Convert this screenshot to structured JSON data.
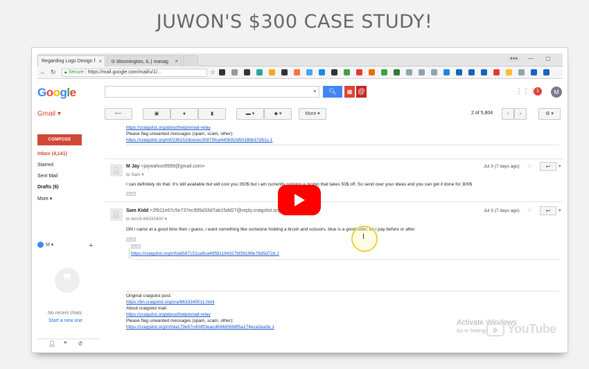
{
  "headline": "JUWON'S $300 CASE STUDY!",
  "browser": {
    "tabs": [
      "Regarding Logo Design f",
      "bloomington, IL | manag"
    ],
    "url_secure": "Secure",
    "url": "https://mail.google.com/mail/u/1/...",
    "minimize": "—",
    "restore": "▢"
  },
  "gmail": {
    "logo": "Google",
    "label": "Gmail ▾",
    "compose": "COMPOSE",
    "nav": [
      {
        "label": "Inbox (4,141)",
        "style": "red"
      },
      {
        "label": "Starred",
        "style": ""
      },
      {
        "label": "Sent Mail",
        "style": ""
      },
      {
        "label": "Drafts (6)",
        "style": "bold"
      },
      {
        "label": "More ▾",
        "style": ""
      }
    ],
    "hangouts_user": "M ▾",
    "no_chats": "No recent chats",
    "start_new": "Start a new one",
    "toolbar": {
      "more": "More ▾",
      "count": "2 of 5,804"
    },
    "notif_count": "1",
    "account_initial": "M"
  },
  "thread": {
    "top_lines": [
      {
        "text": "https://craigslist.org/about/help/email-relay",
        "link": true
      },
      {
        "text": "Please flag unwanted messages (spam, scam, other):",
        "link": false
      },
      {
        "text": "https://craigslist.org/mf/236152dcecec30870fca440b91fd5018bb37d51c.1",
        "link": true
      }
    ],
    "msg1": {
      "sender": "M Jay",
      "email": "<jaywahoo9999@gmail.com>",
      "to": "to Sam",
      "date": "Jul 3 (7 days ago)",
      "body": "I can definitely do that. It's still available but will cost you 350$ but I am currently running a promo that takes 50$ off. So send over your ideas and you can get it done for 300$"
    },
    "msg2": {
      "sender": "Sam Kidd",
      "email": "<2f911e67c5e737ec995d33d7ab15dd27@reply.craigslist.org>",
      "to": "to twrz9-66333400",
      "date": "Jul 3 (7 days ago)",
      "body": "Ohl i came at a good time then i guess, i want something like someone holding a brush and scissors. blue is a good color, do i pay before or after.",
      "quoted_link": "https://craigslist.org/mf/ab587151ca8ca49581194327bf39198e78d5d72d.1"
    },
    "bottom_lines": [
      {
        "text": "Original craigslist post:",
        "link": false
      },
      {
        "text": "https://bn.craigslist.org/cra/6633340011.html",
        "link": true
      },
      {
        "text": "About craigslist mail:",
        "link": false
      },
      {
        "text": "https://craigslist.org/about/help/email-relay",
        "link": true
      },
      {
        "text": "Please flag unwanted messages (spam, scam, other):",
        "link": false
      },
      {
        "text": "https://craigslist.org/mf/da179e67c404ff3eacd69485698f5a174eca2ea3e.1",
        "link": true
      }
    ]
  },
  "overlay": {
    "activate": "Activate Windows",
    "activate_sub": "Go to Settings",
    "youtube": "YouTube"
  },
  "colors": {
    "gmail_red": "#d14836",
    "youtube_red": "#ff0000",
    "link_blue": "#1155cc"
  }
}
